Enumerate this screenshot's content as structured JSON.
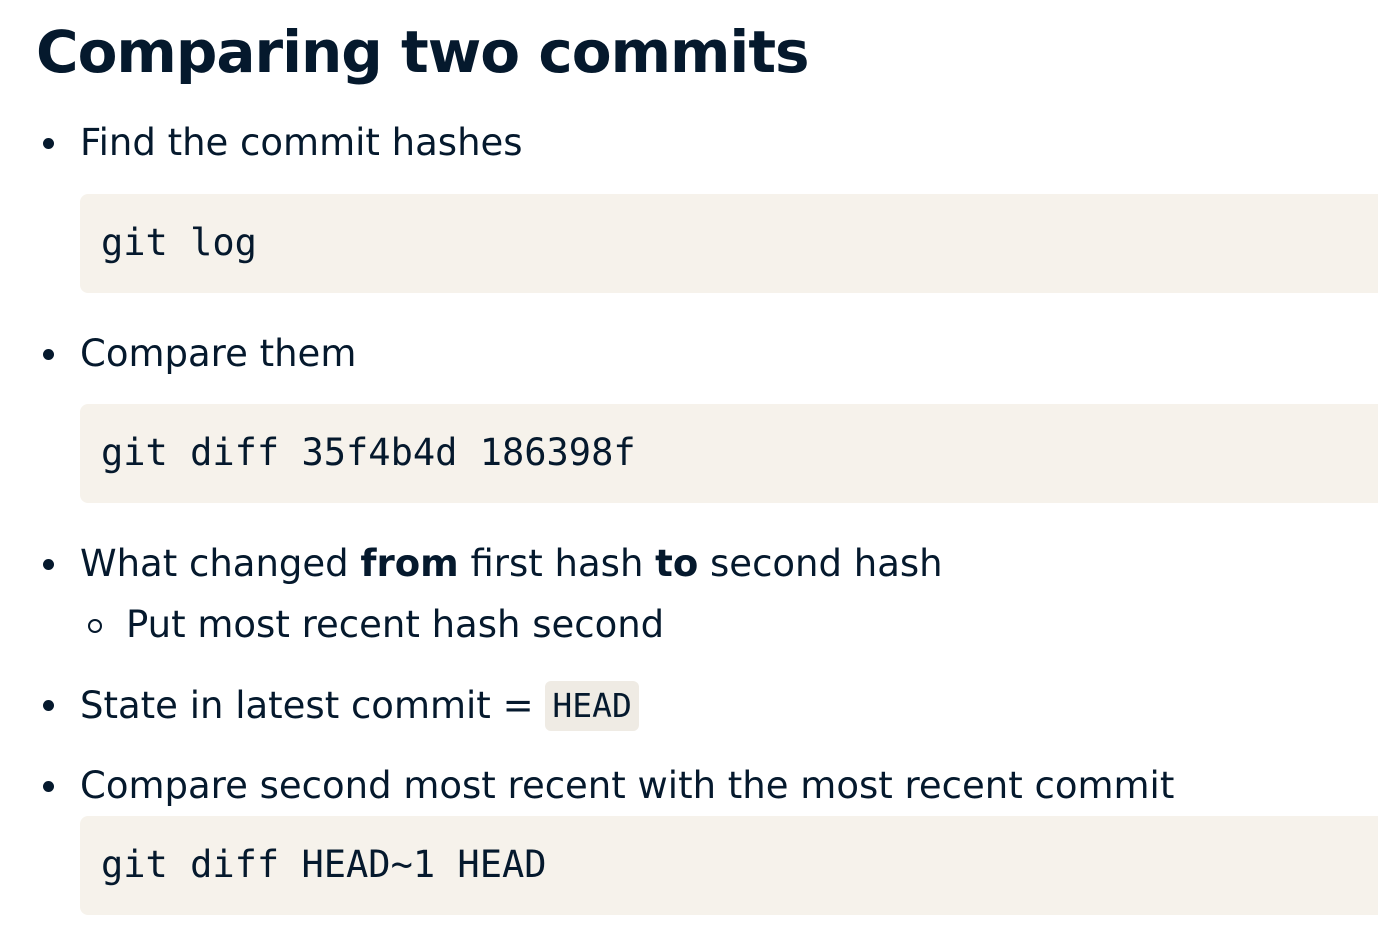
{
  "slide": {
    "title": "Comparing two commits"
  },
  "items": [
    {
      "text": "Find the commit hashes",
      "code": "git log"
    },
    {
      "text": "Compare them",
      "code": "git diff 35f4b4d 186398f"
    },
    {
      "parts": [
        "What changed ",
        "from",
        " first hash ",
        "to",
        " second hash"
      ],
      "sub": "Put most recent hash second"
    },
    {
      "text": "State in latest commit = ",
      "inline_code": "HEAD"
    },
    {
      "text": "Compare second most recent with the most recent commit",
      "code": "git diff HEAD~1 HEAD"
    }
  ]
}
